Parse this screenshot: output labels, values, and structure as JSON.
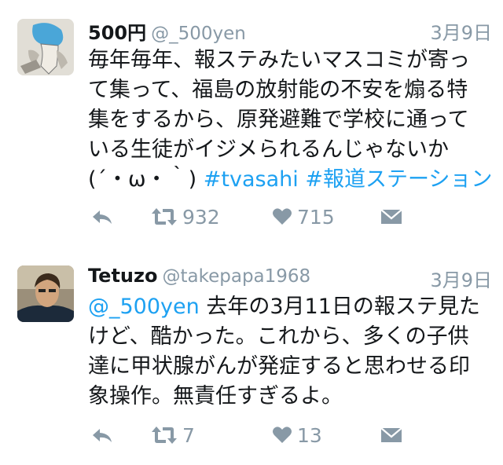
{
  "tweets": [
    {
      "display_name": "500円",
      "handle": "@_500yen",
      "date": "3月9日",
      "text_lines": [
        "毎年毎年、報ステみたいマスコミが寄っ",
        "て集って、福島の放射能の不安を煽る特",
        "集をするから、原発避難で学校に通って",
        "いる生徒がイジメられるんじゃないか"
      ],
      "last_line_text": "(´・ω・｀)",
      "hashtags": [
        "#tvasahi",
        "#報道ステーション"
      ],
      "retweets": "932",
      "likes": "715"
    },
    {
      "display_name": "Tetuzo",
      "handle": "@takepapa1968",
      "date": "3月9日",
      "mention": "@_500yen",
      "first_line_rest": "去年の3月11日の報ステ見た",
      "text_lines": [
        "けど、酷かった。これから、多くの子供",
        "達に甲状腺がんが発症すると思わせる印",
        "象操作。無責任すぎるよ。"
      ],
      "retweets": "7",
      "likes": "13"
    }
  ],
  "colors": {
    "text": "#14171a",
    "secondary": "#8899a6",
    "link": "#1da1f2",
    "background": "#ffffff"
  },
  "icons": {
    "reply": "reply-arrow-icon",
    "retweet": "retweet-icon",
    "like": "heart-icon",
    "message": "envelope-icon"
  }
}
